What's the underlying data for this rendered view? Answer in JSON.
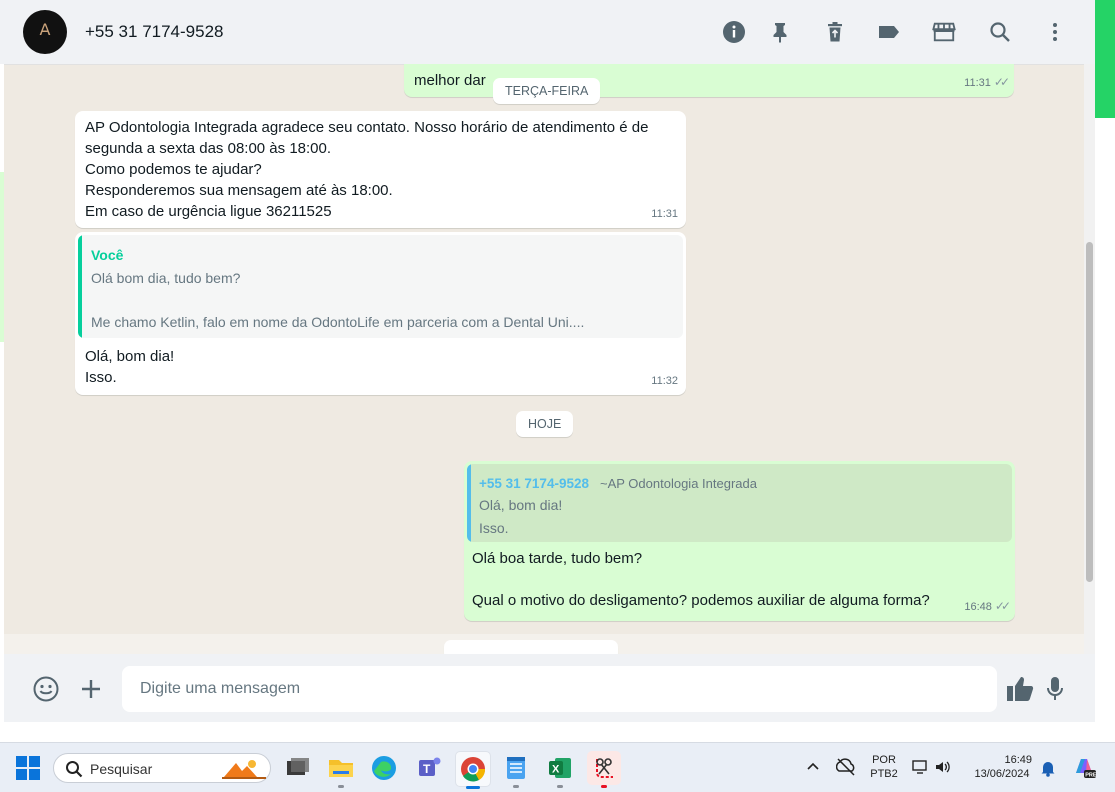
{
  "header": {
    "contact_name": "+55 31 7174-9528",
    "icons": [
      "info-icon",
      "pin-icon",
      "trash-icon",
      "label-icon",
      "store-icon",
      "search-icon",
      "menu-dots-icon"
    ]
  },
  "messages": {
    "top_partial_text": "melhor dar",
    "top_partial_time": "11:31",
    "date_tuesday": "TERÇA-FEIRA",
    "auto_reply": {
      "lines": [
        "AP Odontologia Integrada agradece seu contato. Nosso horário de atendimento é de",
        "segunda a sexta das 08:00 às 18:00.",
        "Como podemos te ajudar?",
        "Responderemos sua mensagem até às 18:00.",
        "Em caso de urgência ligue 36211525"
      ],
      "time": "11:31"
    },
    "reply_in": {
      "quote_author": "Você",
      "quote_line1": "Olá bom dia, tudo bem?",
      "quote_line2": "Me chamo Ketlin, falo em nome da OdontoLife em parceria com a Dental Uni....",
      "lines": [
        "Olá, bom dia!",
        "Isso."
      ],
      "time": "11:32"
    },
    "date_today": "HOJE",
    "reply_out": {
      "quote_author": "+55 31 7174-9528",
      "quote_author_alias": "~AP Odontologia Integrada",
      "quote_line1": "Olá, bom dia!",
      "quote_line2": "Isso.",
      "line1": "Olá boa tarde, tudo bem?",
      "line2": "Qual o motivo do desligamento? podemos auxiliar de alguma forma?",
      "time": "16:48"
    },
    "colors": {
      "incoming": "#ffffff",
      "outgoing": "#d9fdd3",
      "quote_in_bar": "#06cf9c",
      "quote_out_bar": "#53bdeb"
    }
  },
  "composer": {
    "placeholder": "Digite uma mensagem",
    "icons": [
      "emoji-icon",
      "plus-icon",
      "thumbs-up-icon",
      "microphone-icon"
    ]
  },
  "taskbar": {
    "search_label": "Pesquisar",
    "lang_line1": "POR",
    "lang_line2": "PTB2",
    "clock_time": "16:49",
    "clock_date": "13/06/2024",
    "apps": [
      "windows-start-icon",
      "file-explorer-icon",
      "edge-icon",
      "teams-icon",
      "chrome-icon",
      "notepad-icon",
      "excel-icon",
      "snipping-tool-icon"
    ]
  }
}
